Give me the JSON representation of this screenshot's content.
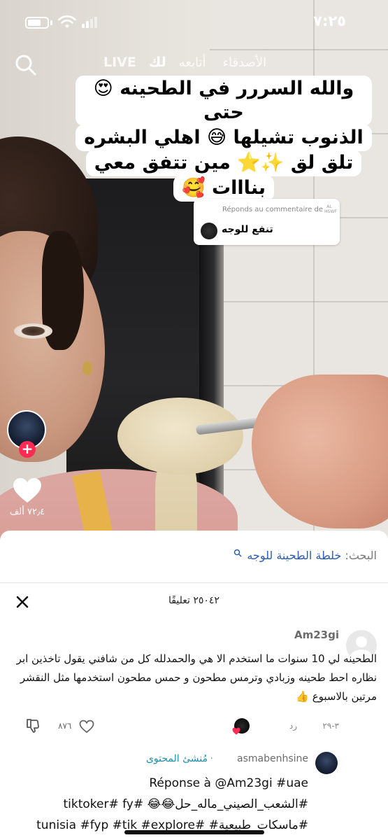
{
  "status_bar": {
    "time": "٧:٢٥"
  },
  "top_nav": {
    "tabs": [
      {
        "label": "LIVE"
      },
      {
        "label": "لك"
      },
      {
        "label": "أتابعه"
      },
      {
        "label": "الأصدقاء"
      }
    ],
    "active_tab": "لك"
  },
  "video": {
    "caption_lines": [
      "والله السررر في الطحينه 😍حتى",
      "الذنوب تشيلها 😅 اهلي البشره",
      "تلق لق ✨⭐ مين تتفق معي",
      "بنااات 🥰"
    ],
    "reply_sticker": {
      "label": "Réponds au commentaire de",
      "user": "AL HSWF",
      "text": "تنفع للوجه"
    },
    "like_count": "٧٢٫٤ ألف"
  },
  "sheet": {
    "search_label": "البحث:",
    "search_query": "خلطة الطحينة للوجه",
    "comments_count": "٢٥٠٤٢ تعليقًا",
    "comments": [
      {
        "user": "Am23gi",
        "text": "الطحينه لي 10 سنوات ما استخدم الا هي والحمدلله كل من شافني يقول تاخذين ابر نظاره احط طحينه وزبادي وترمس مطحون و حمس مطحون استخدمها مثل النقشر مرتين بالاسبوع 👍",
        "date": "٣-٢٩",
        "reply_label": "رد",
        "likes": "٨٧٦"
      },
      {
        "user": "asmabenhsine",
        "creator_badge": "مُنشئ المحتوى",
        "text": "Réponse à @Am23gi #uae\n#الشعب_الصيني_ماله_حل😂😂 #tiktoker# fy\n#ماسكات_طبيعية# #tunisia #fyp #tik #explore"
      }
    ]
  },
  "colors": {
    "accent_red": "#fe2c55",
    "link_blue": "#2a5db0",
    "creator_teal": "#1f8ea5"
  }
}
